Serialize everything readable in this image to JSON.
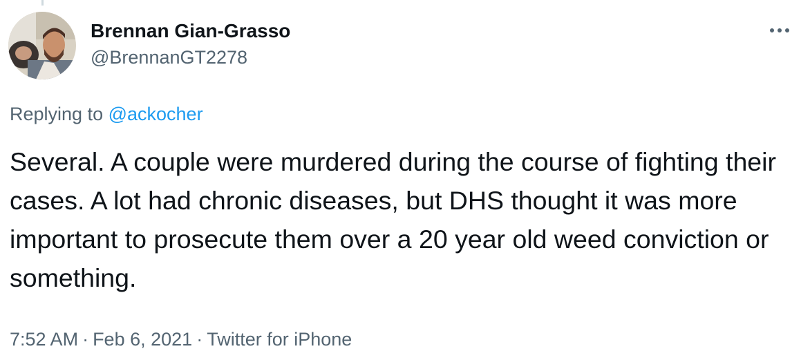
{
  "tweet": {
    "author": {
      "display_name": "Brennan Gian-Grasso",
      "handle": "@BrennanGT2278"
    },
    "replying_prefix": "Replying to ",
    "replying_to": "@ackocher",
    "text": "Several. A couple were murdered during the course of fighting their cases. A lot had chronic diseases, but DHS thought it was more important to prosecute them over a 20 year old weed conviction or something.",
    "time": "7:52 AM",
    "separator": "·",
    "date": "Feb 6, 2021",
    "source": "Twitter for iPhone",
    "more_icon": "more-horizontal-icon"
  },
  "colors": {
    "primary_text": "#0f1419",
    "secondary_text": "#536471",
    "link": "#1d9bf0",
    "background": "#ffffff",
    "thread_line": "#cfd9de"
  }
}
